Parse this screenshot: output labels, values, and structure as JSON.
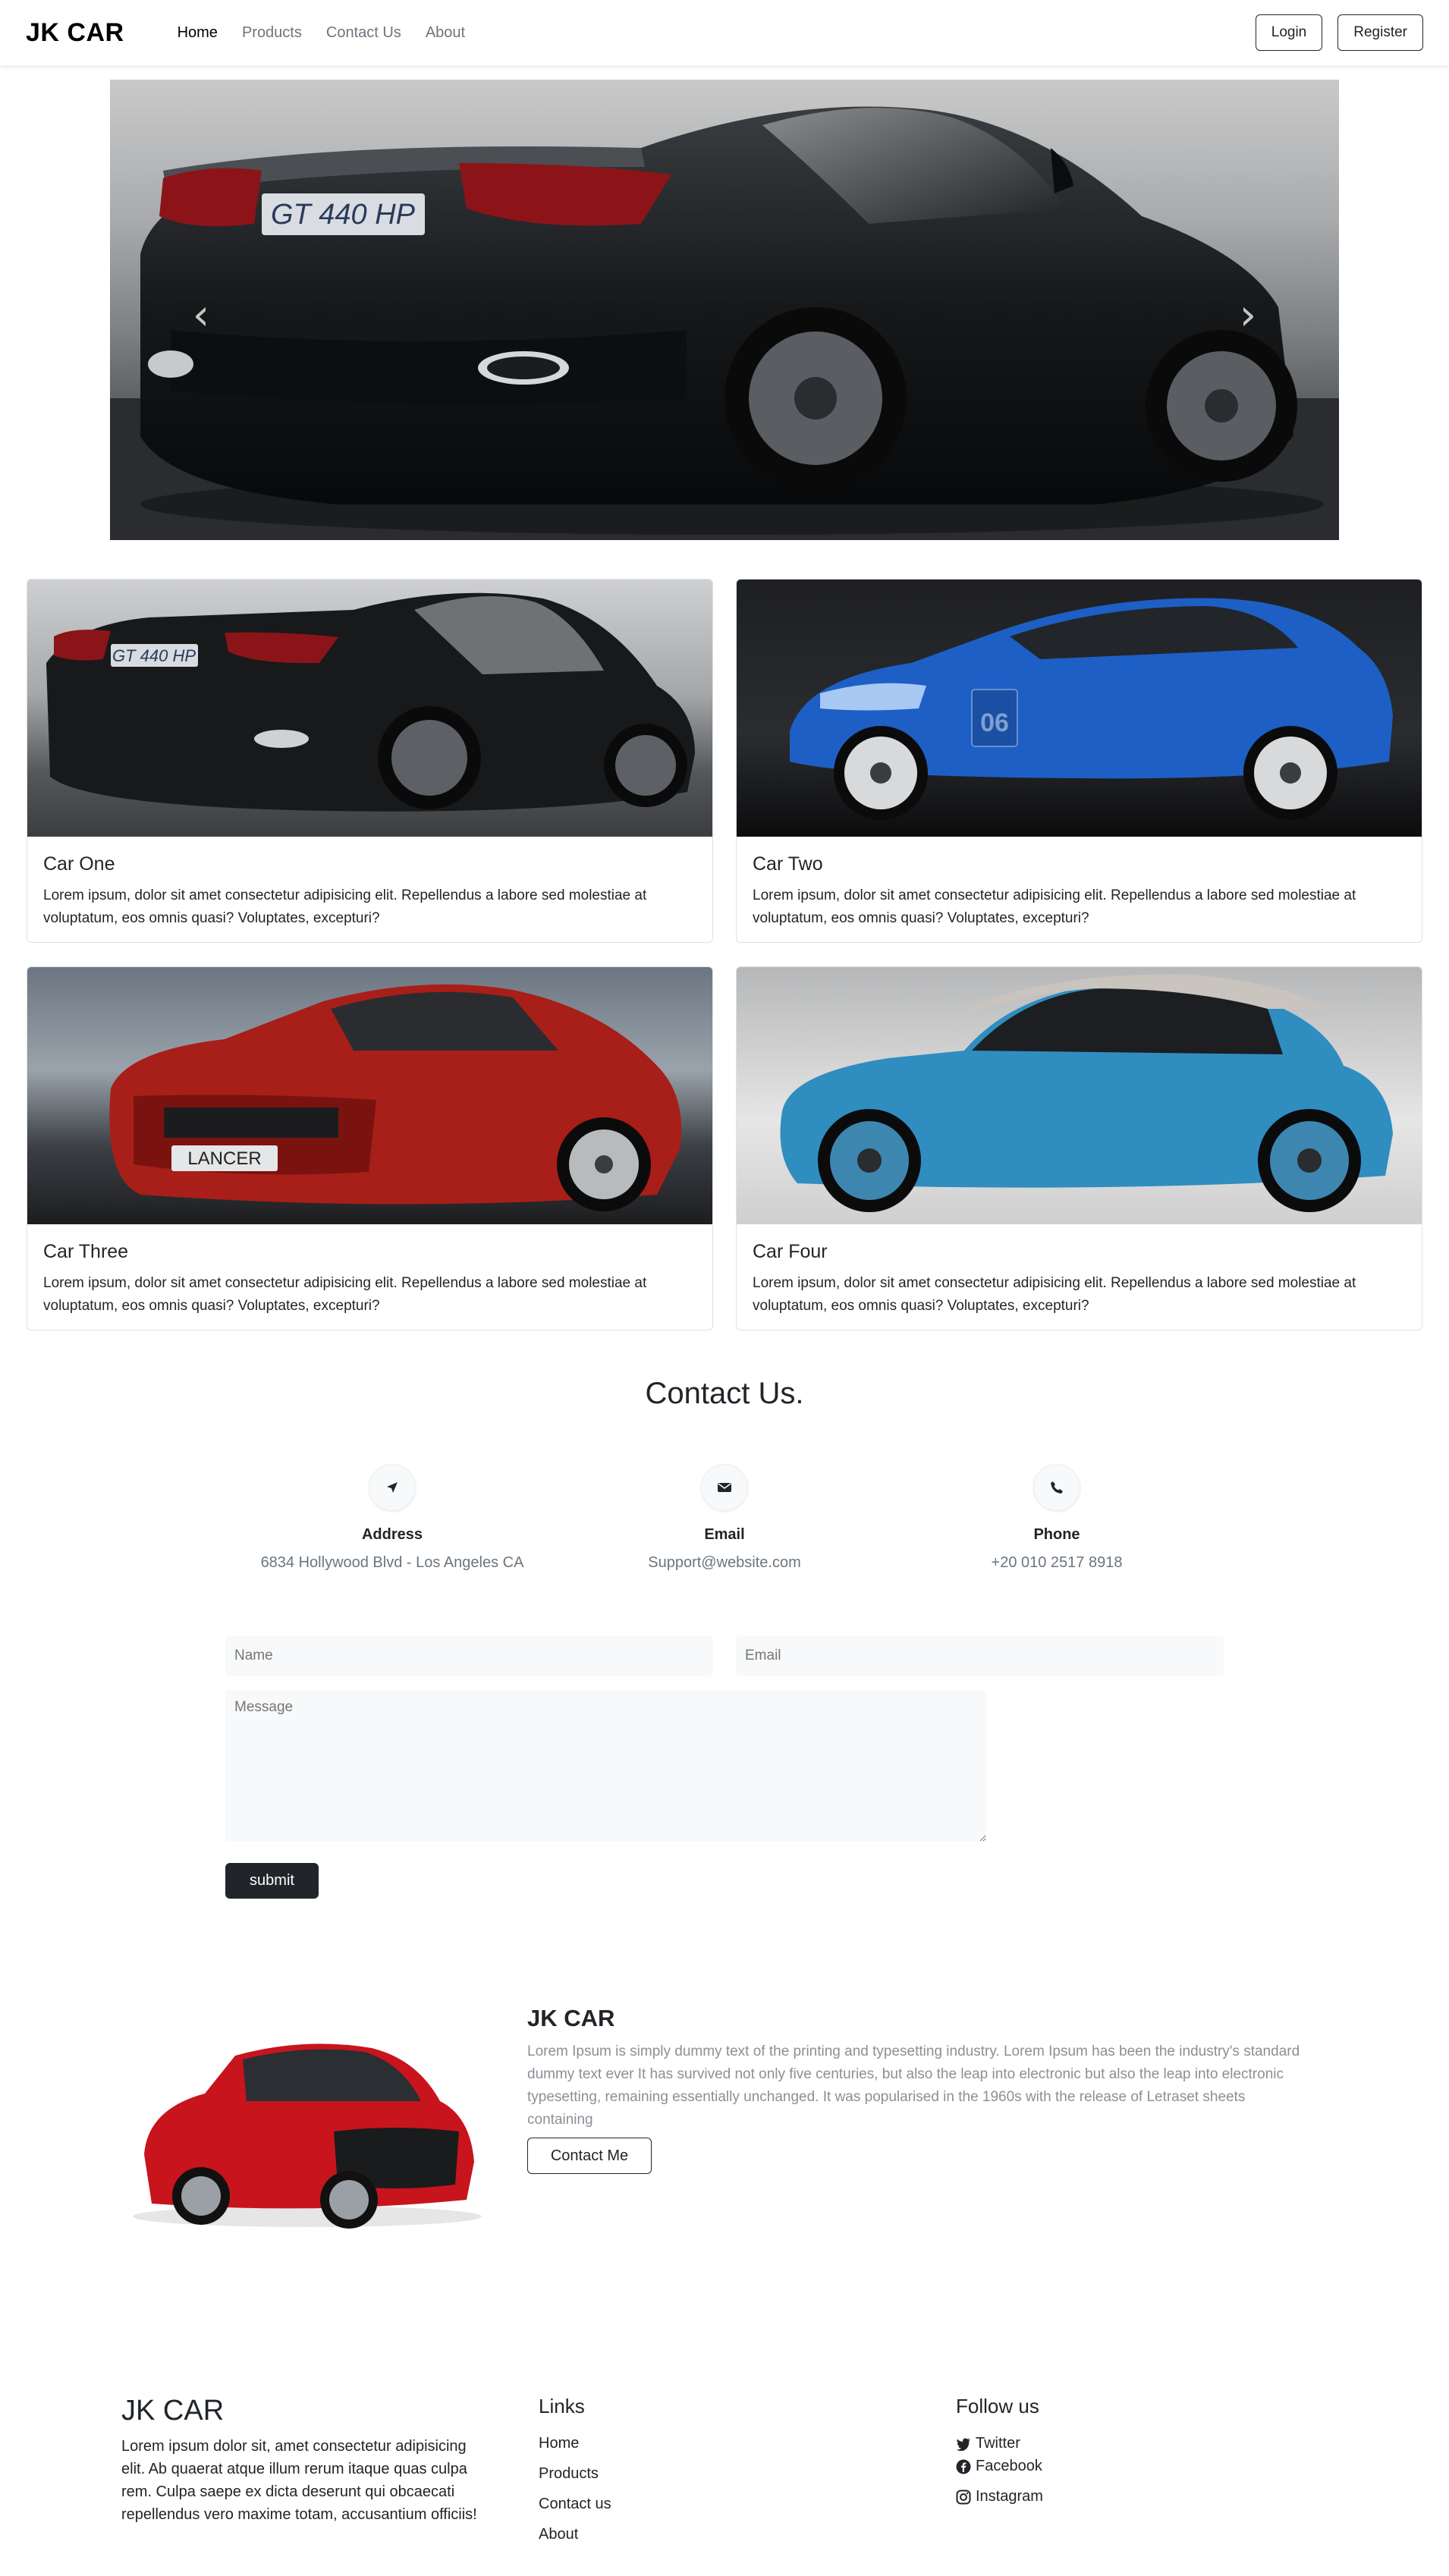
{
  "nav": {
    "brand": "JK CAR",
    "links": [
      "Home",
      "Products",
      "Contact Us",
      "About"
    ],
    "login": "Login",
    "register": "Register"
  },
  "hero": {
    "plate": "GT 440 HP",
    "prev_icon": "chevron-left-icon",
    "next_icon": "chevron-right-icon"
  },
  "cards": [
    {
      "title": "Car One",
      "text": "Lorem ipsum, dolor sit amet consectetur adipisicing elit. Repellendus a labore sed molestiae at voluptatum, eos omnis quasi? Voluptates, excepturi?",
      "plate": "GT 440 HP"
    },
    {
      "title": "Car Two",
      "text": "Lorem ipsum, dolor sit amet consectetur adipisicing elit. Repellendus a labore sed molestiae at voluptatum, eos omnis quasi? Voluptates, excepturi?",
      "plate": "06"
    },
    {
      "title": "Car Three",
      "text": "Lorem ipsum, dolor sit amet consectetur adipisicing elit. Repellendus a labore sed molestiae at voluptatum, eos omnis quasi? Voluptates, excepturi?",
      "plate": "LANCER"
    },
    {
      "title": "Car Four",
      "text": "Lorem ipsum, dolor sit amet consectetur adipisicing elit. Repellendus a labore sed molestiae at voluptatum, eos omnis quasi? Voluptates, excepturi?"
    }
  ],
  "contact": {
    "title": "Contact Us.",
    "items": [
      {
        "label": "Address",
        "value": "6834 Hollywood Blvd - Los Angeles CA",
        "icon": "location-arrow-icon"
      },
      {
        "label": "Email",
        "value": "Support@website.com",
        "icon": "envelope-icon"
      },
      {
        "label": "Phone",
        "value": "+20 010 2517 8918",
        "icon": "phone-icon"
      }
    ],
    "form": {
      "name_placeholder": "Name",
      "email_placeholder": "Email",
      "message_placeholder": "Message",
      "submit": "submit"
    }
  },
  "about": {
    "title": "JK CAR",
    "text": "Lorem Ipsum is simply dummy text of the printing and typesetting industry. Lorem Ipsum has been the industry's standard dummy text ever It has survived not only five centuries, but also the leap into electronic but also the leap into electronic typesetting, remaining essentially unchanged. It was popularised in the 1960s with the release of Letraset sheets containing",
    "button": "Contact Me"
  },
  "footer": {
    "brand": "JK CAR",
    "text": "Lorem ipsum dolor sit, amet consectetur adipisicing elit. Ab quaerat atque illum rerum itaque quas culpa rem. Culpa saepe ex dicta deserunt qui obcaecati repellendus vero maxime totam, accusantium officiis!",
    "links_title": "Links",
    "links": [
      "Home",
      "Products",
      "Contact us",
      "About"
    ],
    "follow_title": "Follow us",
    "social": [
      {
        "label": "Twitter",
        "icon": "twitter-icon"
      },
      {
        "label": "Facebook",
        "icon": "facebook-icon"
      },
      {
        "label": "Instagram",
        "icon": "instagram-icon"
      }
    ]
  },
  "colors": {
    "dark": "#212529",
    "muted": "#6c757d",
    "field_bg": "#f8f9fa",
    "border": "#dee2e6"
  }
}
